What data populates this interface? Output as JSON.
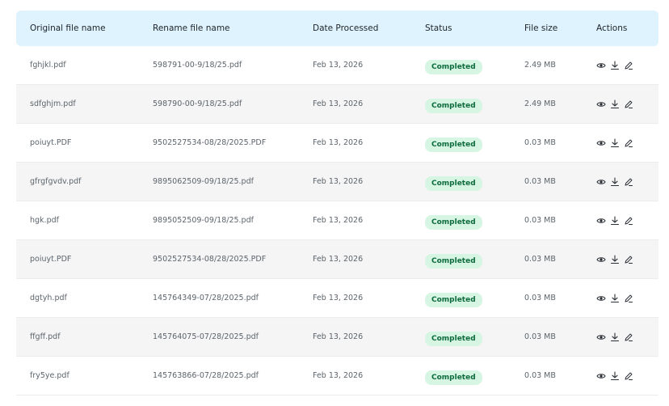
{
  "columns": {
    "original": "Original file name",
    "renamed": "Rename file name",
    "date": "Date Processed",
    "status": "Status",
    "size": "File size",
    "actions": "Actions"
  },
  "rows": [
    {
      "original": "fghjkl.pdf",
      "renamed": "598791-00-9/18/25.pdf",
      "date": "Feb 13, 2026",
      "status": "Completed",
      "size": "2.49 MB"
    },
    {
      "original": "sdfghjm.pdf",
      "renamed": "598790-00-9/18/25.pdf",
      "date": "Feb 13, 2026",
      "status": "Completed",
      "size": "2.49 MB"
    },
    {
      "original": "poiuyt.PDF",
      "renamed": "9502527534-08/28/2025.PDF",
      "date": "Feb 13, 2026",
      "status": "Completed",
      "size": "0.03 MB"
    },
    {
      "original": "gfrgfgvdv.pdf",
      "renamed": "9895062509-09/18/25.pdf",
      "date": "Feb 13, 2026",
      "status": "Completed",
      "size": "0.03 MB"
    },
    {
      "original": "hgk.pdf",
      "renamed": "9895052509-09/18/25.pdf",
      "date": "Feb 13, 2026",
      "status": "Completed",
      "size": "0.03 MB"
    },
    {
      "original": "poiuyt.PDF",
      "renamed": "9502527534-08/28/2025.PDF",
      "date": "Feb 13, 2026",
      "status": "Completed",
      "size": "0.03 MB"
    },
    {
      "original": "dgtyh.pdf",
      "renamed": "145764349-07/28/2025.pdf",
      "date": "Feb 13, 2026",
      "status": "Completed",
      "size": "0.03 MB"
    },
    {
      "original": "ffgff.pdf",
      "renamed": "145764075-07/28/2025.pdf",
      "date": "Feb 13, 2026",
      "status": "Completed",
      "size": "0.03 MB"
    },
    {
      "original": "fry5ye.pdf",
      "renamed": "145763866-07/28/2025.pdf",
      "date": "Feb 13, 2026",
      "status": "Completed",
      "size": "0.03 MB"
    }
  ],
  "icons": {
    "view": "eye-icon",
    "download": "download-icon",
    "edit": "pencil-icon"
  },
  "colors": {
    "header_bg": "#def3fd",
    "status_bg": "#d6f5e3",
    "status_text": "#0e6b3c",
    "alt_row_bg": "#f5f5f5"
  }
}
